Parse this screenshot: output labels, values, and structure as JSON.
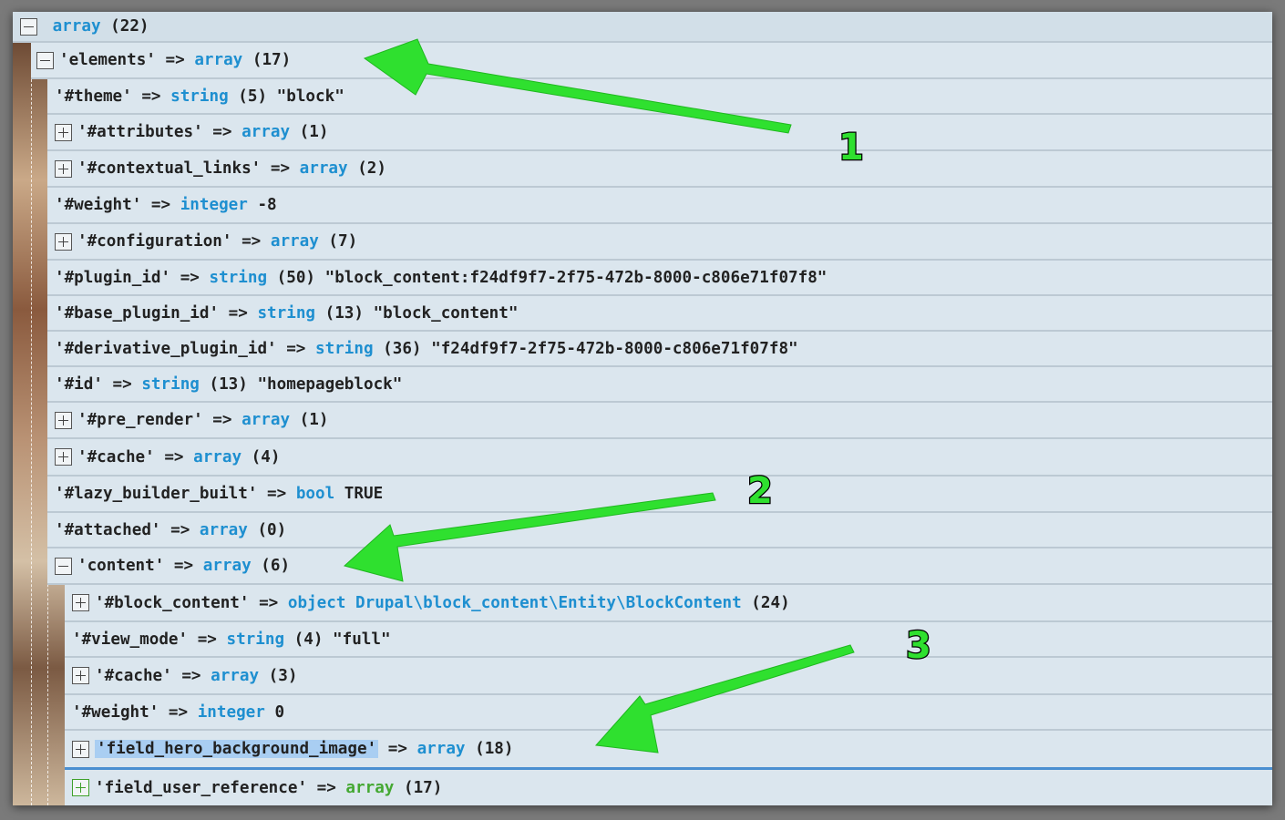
{
  "rows": [
    {
      "toggle": "minus",
      "key": "array",
      "type": "",
      "rest": " (22)"
    },
    {
      "toggle": "minus",
      "key": "'elements'",
      "type": "array",
      "rest": " (17)"
    },
    {
      "toggle": "",
      "key": "'#theme'",
      "type": "string",
      "rest": " (5) \"block\""
    },
    {
      "toggle": "plus",
      "key": "'#attributes'",
      "type": "array",
      "rest": " (1)"
    },
    {
      "toggle": "plus",
      "key": "'#contextual_links'",
      "type": "array",
      "rest": " (2)"
    },
    {
      "toggle": "",
      "key": "'#weight'",
      "type": "integer",
      "rest": " -8"
    },
    {
      "toggle": "plus",
      "key": "'#configuration'",
      "type": "array",
      "rest": " (7)"
    },
    {
      "toggle": "",
      "key": "'#plugin_id'",
      "type": "string",
      "rest": " (50) \"block_content:f24df9f7-2f75-472b-8000-c806e71f07f8\""
    },
    {
      "toggle": "",
      "key": "'#base_plugin_id'",
      "type": "string",
      "rest": " (13) \"block_content\""
    },
    {
      "toggle": "",
      "key": "'#derivative_plugin_id'",
      "type": "string",
      "rest": " (36) \"f24df9f7-2f75-472b-8000-c806e71f07f8\""
    },
    {
      "toggle": "",
      "key": "'#id'",
      "type": "string",
      "rest": " (13) \"homepageblock\""
    },
    {
      "toggle": "plus",
      "key": "'#pre_render'",
      "type": "array",
      "rest": " (1)"
    },
    {
      "toggle": "plus",
      "key": "'#cache'",
      "type": "array",
      "rest": " (4)"
    },
    {
      "toggle": "",
      "key": "'#lazy_builder_built'",
      "type": "bool",
      "rest": " TRUE"
    },
    {
      "toggle": "",
      "key": "'#attached'",
      "type": "array",
      "rest": " (0)"
    },
    {
      "toggle": "minus",
      "key": "'content'",
      "type": "array",
      "rest": " (6)"
    },
    {
      "toggle": "plus",
      "key": "'#block_content'",
      "type": "object Drupal\\block_content\\Entity\\BlockContent",
      "rest": " (24)"
    },
    {
      "toggle": "",
      "key": "'#view_mode'",
      "type": "string",
      "rest": " (4) \"full\""
    },
    {
      "toggle": "plus",
      "key": "'#cache'",
      "type": "array",
      "rest": " (3)"
    },
    {
      "toggle": "",
      "key": "'#weight'",
      "type": "integer",
      "rest": " 0"
    },
    {
      "toggle": "plus",
      "key": "'field_hero_background_image'",
      "type": "array",
      "rest": " (18)"
    },
    {
      "toggle": "plus",
      "key": "'field_user_reference'",
      "type": "array",
      "rest": " (17)"
    }
  ],
  "operator": " => ",
  "annotations": {
    "label1": "1",
    "label2": "2",
    "label3": "3"
  },
  "colors": {
    "type_blue": "#1e8fd0",
    "type_green": "#44a832",
    "arrow_green": "#2fe02f",
    "selection": "#a9cef2"
  }
}
